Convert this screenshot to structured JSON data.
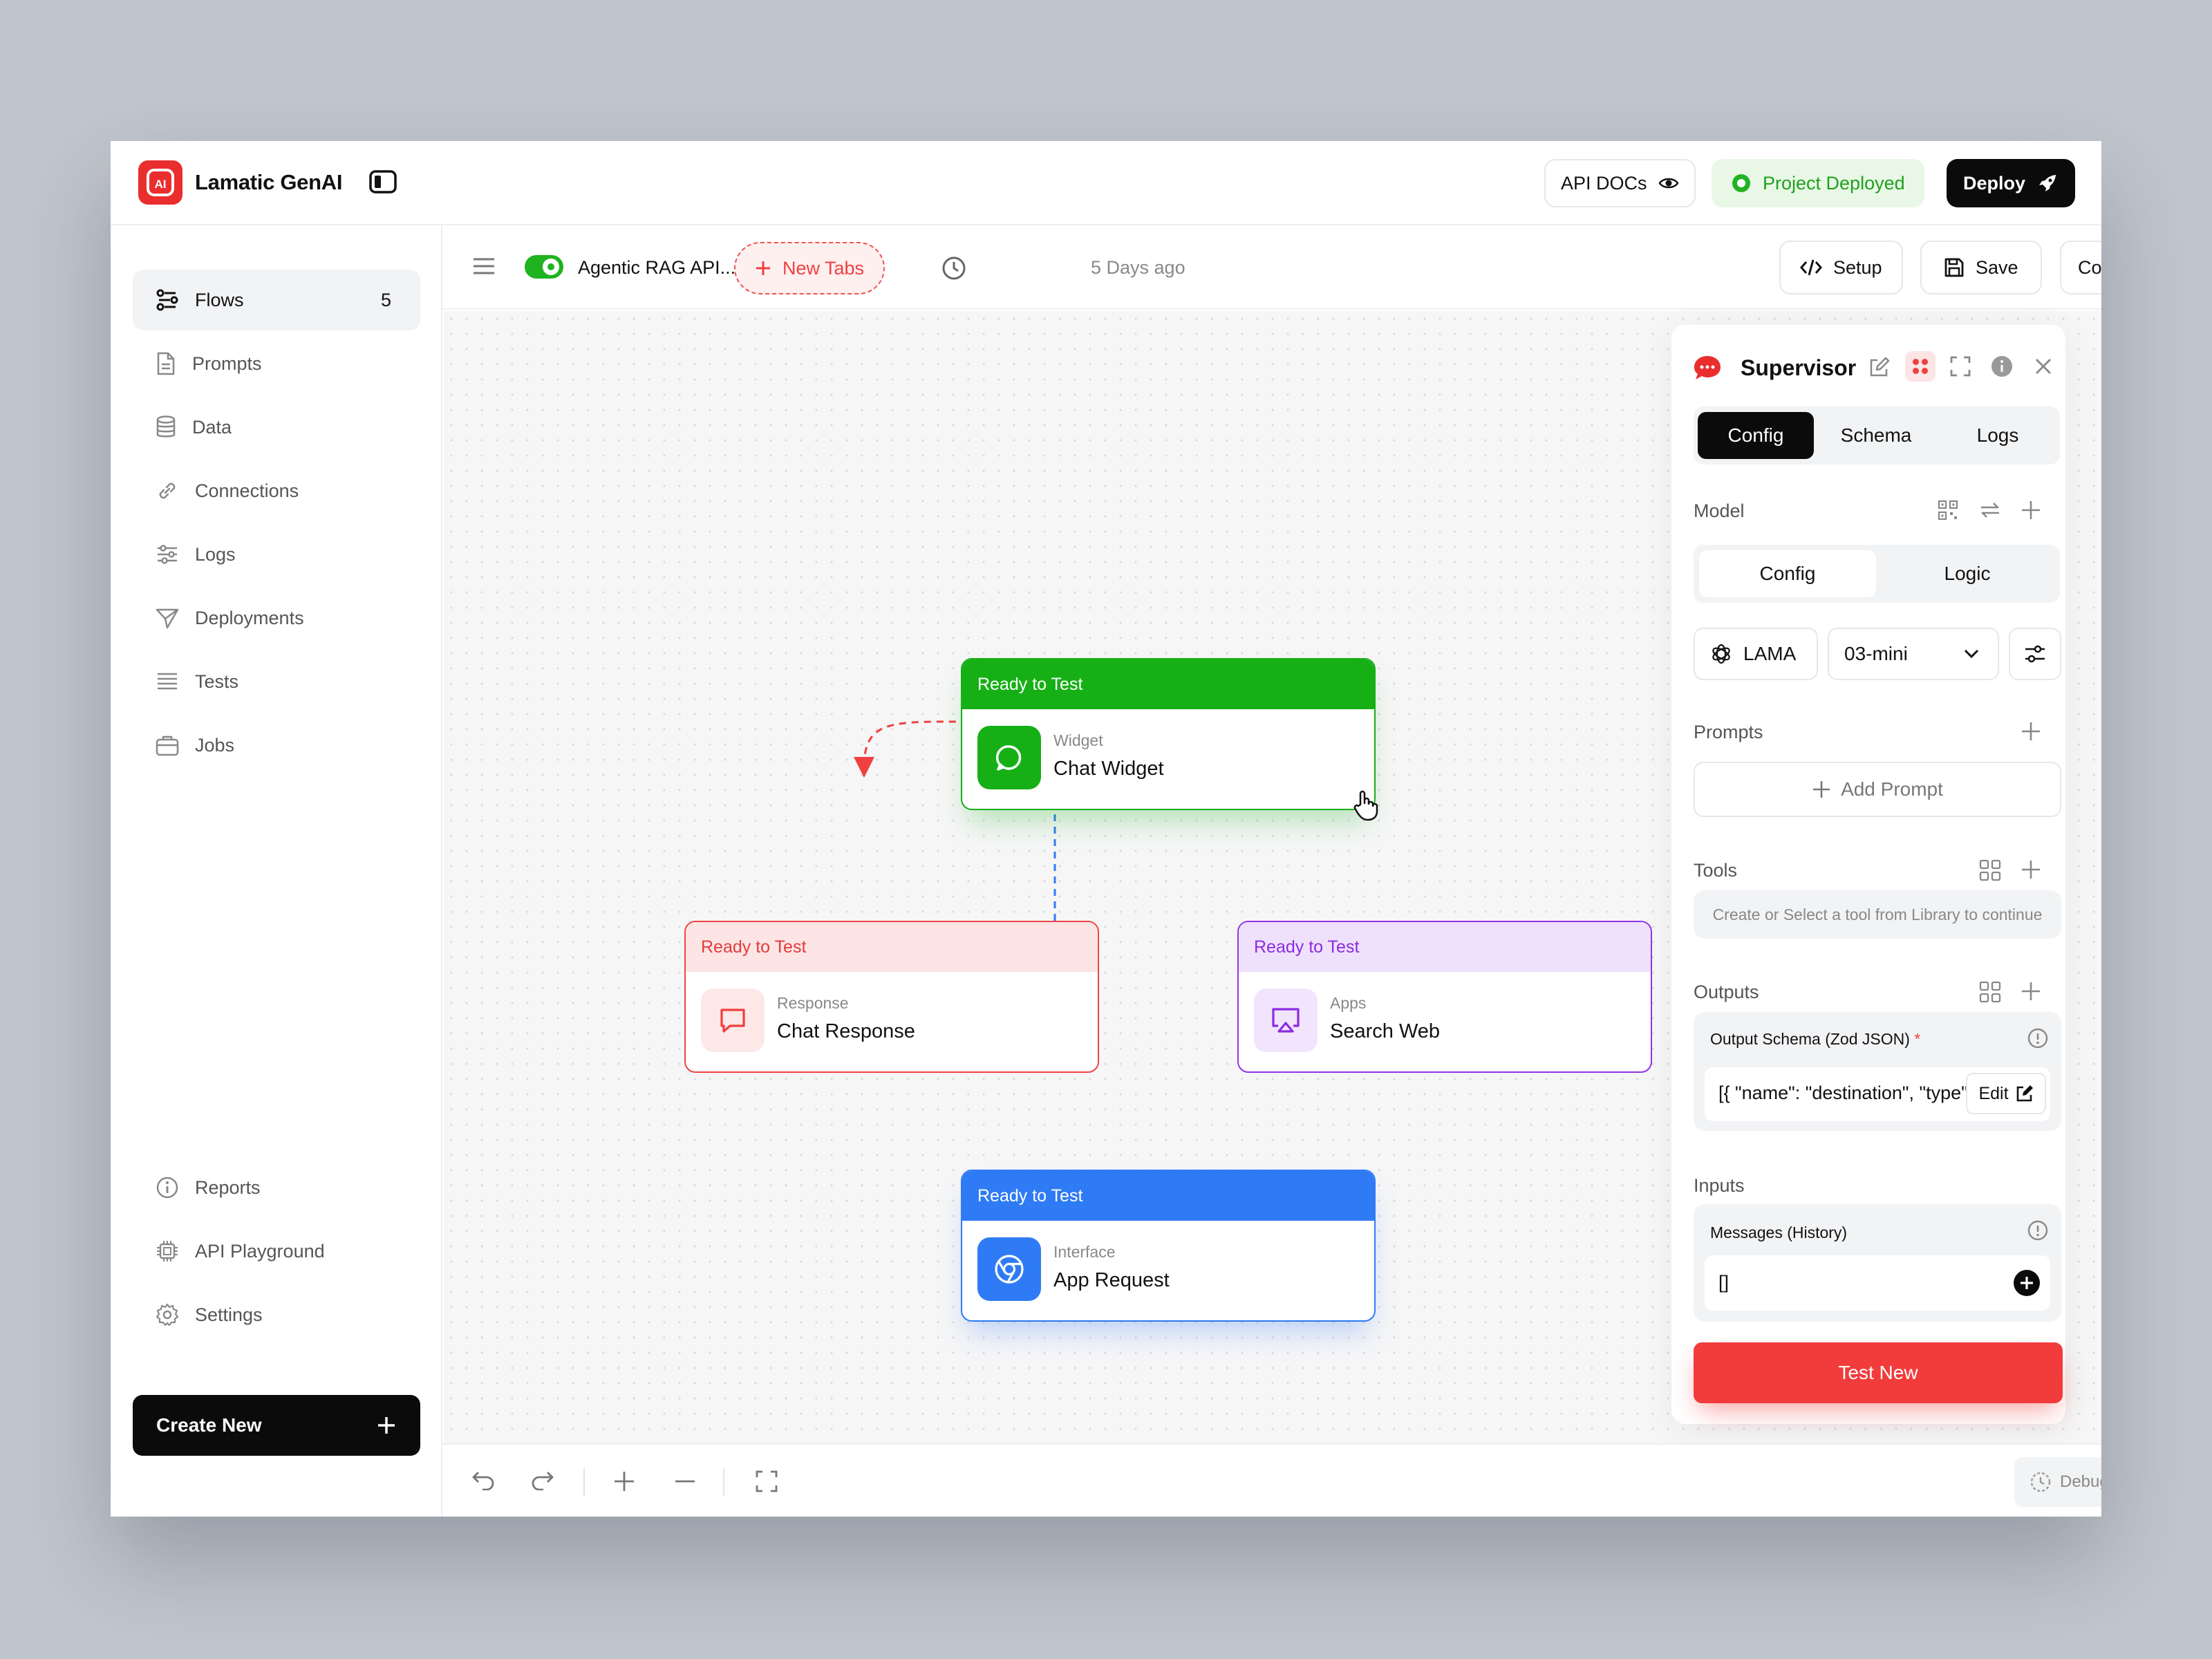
{
  "app": {
    "name": "Lamatic GenAI"
  },
  "header": {
    "api_docs": "API DOCs",
    "status": "Project Deployed",
    "deploy": "Deploy"
  },
  "sidebar": {
    "items": [
      {
        "label": "Flows",
        "count": "5",
        "icon": "flows-icon"
      },
      {
        "label": "Prompts",
        "icon": "document-icon"
      },
      {
        "label": "Data",
        "icon": "database-icon"
      },
      {
        "label": "Connections",
        "icon": "link-icon"
      },
      {
        "label": "Logs",
        "icon": "sliders-icon"
      },
      {
        "label": "Deployments",
        "icon": "send-icon"
      },
      {
        "label": "Tests",
        "icon": "list-icon"
      },
      {
        "label": "Jobs",
        "icon": "briefcase-icon"
      }
    ],
    "bottom": [
      {
        "label": "Reports",
        "icon": "info-icon"
      },
      {
        "label": "API Playground",
        "icon": "chip-icon"
      },
      {
        "label": "Settings",
        "icon": "gear-icon"
      }
    ],
    "create": "Create New"
  },
  "toolbar": {
    "flow_name": "Agentic RAG API...",
    "new_tabs": "New Tabs",
    "updated": "5 Days ago",
    "setup": "Setup",
    "save": "Save",
    "config": "Config"
  },
  "nodes": {
    "widget": {
      "status": "Ready to Test",
      "type": "Widget",
      "title": "Chat Widget",
      "color": "#16b016"
    },
    "response": {
      "status": "Ready to Test",
      "type": "Response",
      "title": "Chat Response",
      "color": "#ef4444"
    },
    "apps": {
      "status": "Ready to Test",
      "type": "Apps",
      "title": "Search Web",
      "color": "#9333ea"
    },
    "interface": {
      "status": "Ready to Test",
      "type": "Interface",
      "title": "App Request",
      "color": "#2f7bf5"
    }
  },
  "panel": {
    "title": "Supervisor",
    "tabs": [
      "Config",
      "Schema",
      "Logs"
    ],
    "active_tab": "Config",
    "model_label": "Model",
    "model_tabs": [
      "Config",
      "Logic"
    ],
    "provider": "LAMA",
    "model": "03-mini",
    "prompts_label": "Prompts",
    "add_prompt": "Add Prompt",
    "tools_label": "Tools",
    "tools_hint": "Create or Select a tool from Library to continue",
    "outputs_label": "Outputs",
    "output_schema_label": "Output Schema (Zod JSON)",
    "required_mark": "*",
    "output_schema_value": "[{ \"name\": \"destination\", \"type\": \"string\" }]",
    "edit": "Edit",
    "inputs_label": "Inputs",
    "messages_label": "Messages (History)",
    "messages_value": "[]",
    "test_button": "Test New"
  },
  "bottombar": {
    "debug": "Debug"
  }
}
